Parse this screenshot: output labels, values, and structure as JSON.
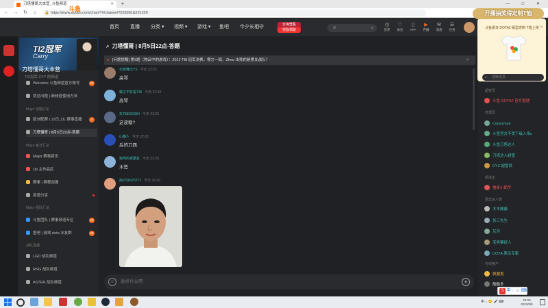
{
  "browser": {
    "tab_title": "刀塔懂哥大本营_斗鱼频道",
    "url": "https://www.douyu.com/chan/?#/channel?229381&221226",
    "window_controls": [
      "—",
      "□",
      "✕"
    ]
  },
  "header": {
    "logo": "斗鱼",
    "nav": [
      "首页",
      "直播",
      "分类",
      "视频",
      "游戏",
      "鱼吧",
      "今夕长相守"
    ],
    "promo_badge": "云海登基",
    "promo_badge_sub": "奖励领取",
    "search_placeholder": "dt",
    "icons": [
      {
        "name": "history-icon",
        "label": "历史"
      },
      {
        "name": "follow-icon",
        "label": "关注"
      },
      {
        "name": "app-icon",
        "label": "APP"
      },
      {
        "name": "create-icon",
        "label": "开播"
      },
      {
        "name": "message-icon",
        "label": "消息"
      },
      {
        "name": "tasks-icon",
        "label": "任务"
      }
    ]
  },
  "left_panel": {
    "banner_title": "TI2冠军",
    "banner_subtitle": "Carry",
    "channel_name": "刀塔懂哥大本营",
    "channel_desc": "TI2冠军 CFY 的频道",
    "sections": [
      {
        "title": "",
        "items": [
          {
            "label": "Welcome 斗鱼频道官方账号",
            "badge": "20"
          },
          {
            "label": "常见问题 | 新频道使用方法",
            "badge": ""
          }
        ]
      },
      {
        "title": "Major 话题讨论",
        "items": [
          {
            "label": "欧洲联赛 | 12日_DL 赛事直播",
            "badge": "4",
            "active": false
          },
          {
            "label": "刀塔懂哥 | 8月5日22点-答题",
            "badge": "",
            "active": true
          }
        ]
      },
      {
        "title": "Major 官方汇总",
        "items": [
          {
            "label": "Major 赛事资讯",
            "badge": ""
          },
          {
            "label": "Up 主作品区",
            "badge": ""
          },
          {
            "label": "赛事 | 赛程战报",
            "badge": ""
          },
          {
            "label": "资源分享",
            "badge": "",
            "dot": true
          }
        ]
      },
      {
        "title": "Major 团队汇总",
        "items": [
          {
            "label": "斗鱼团队 | 赛事频道专区",
            "badge": "25"
          },
          {
            "label": "鱼吧 | 游戏 dota 水友群",
            "badge": "20"
          }
        ]
      },
      {
        "title": "战队直播",
        "items": [
          {
            "label": "LGD 战队频道",
            "badge": ""
          },
          {
            "label": "RNG 战队频道",
            "badge": ""
          },
          {
            "label": "ASTER 战队频道",
            "badge": ""
          }
        ]
      }
    ]
  },
  "chat": {
    "title": "刀塔懂哥 | 8月5日22点-答题",
    "notice": "[问题提醒] 第9题（物品中的游戏）：2012 TI8 冠军决赛，哪方一局，Zhou 击败的是哪支战队？",
    "messages": [
      {
        "name": "石桥懂王YS",
        "time": "今天 22:20",
        "text": "高琴",
        "color": "#9a7c6a"
      },
      {
        "name": "橘子不好看736",
        "time": "今天 22:20",
        "text": "高琴",
        "color": "#7fb2d8"
      },
      {
        "name": "天758502364",
        "time": "今天 22:20",
        "text": "这波稳?",
        "color": "#5a6a86"
      },
      {
        "name": "山猫人",
        "time": "今天 22:20",
        "text": "后的刀西",
        "color": "#2b4fb8"
      },
      {
        "name": "突然的老朋友",
        "time": "今天 22:20",
        "text": "木签",
        "color": "#8fb2d8"
      },
      {
        "name": "用户56375771",
        "time": "今天 22:20",
        "text": "",
        "color": "#e0a080"
      }
    ],
    "input_placeholder": "说点什么吧"
  },
  "right_panel": {
    "promo_ribbon": "开播抽奖得定制T恤",
    "promo_text": "斗鱼夏日 DOTA2 版型定制 T恤上线",
    "search_placeholder": "搜索成员",
    "groups": [
      {
        "title": "超管员",
        "members": [
          {
            "name": "斗鱼 DOTA2 官方管理",
            "color": "#e85050"
          }
        ]
      },
      {
        "title": "管理员",
        "members": [
          {
            "name": "Copeyman",
            "color": "#3fbfb5"
          },
          {
            "name": "斗鱼官方不受下级入场s",
            "color": "#3fbfb5"
          },
          {
            "name": "斗鱼刀塔达人",
            "color": "#3fbfb5"
          },
          {
            "name": "刀塔达人超管",
            "color": "#3fbfb5"
          },
          {
            "name": "DYZ 超管员",
            "color": "#3fbfb5"
          }
        ]
      },
      {
        "title": "频道主",
        "members": [
          {
            "name": "懂哥小助手",
            "color": "#e85050"
          }
        ]
      },
      {
        "title": "嘉宾总人数",
        "members": [
          {
            "name": "木木酱酱",
            "color": "#3fbfb5"
          },
          {
            "name": "张三先生",
            "color": "#3fbfb5"
          },
          {
            "name": "灰河",
            "color": "#3fbfb5"
          },
          {
            "name": "宅男蔡好人",
            "color": "#3fbfb5"
          },
          {
            "name": "DOTA 菜鸟专家",
            "color": "#3fbfb5"
          }
        ]
      },
      {
        "title": "在线用户",
        "members": [
          {
            "name": "佩魔鬼",
            "color": "#e8b040"
          },
          {
            "name": "酷酷多",
            "color": "#cccccc"
          }
        ]
      }
    ]
  },
  "taskbar": {
    "tray": "中 ·, 😊 🎤 ⌨",
    "time": "22:20",
    "date": "2022/8/5"
  }
}
